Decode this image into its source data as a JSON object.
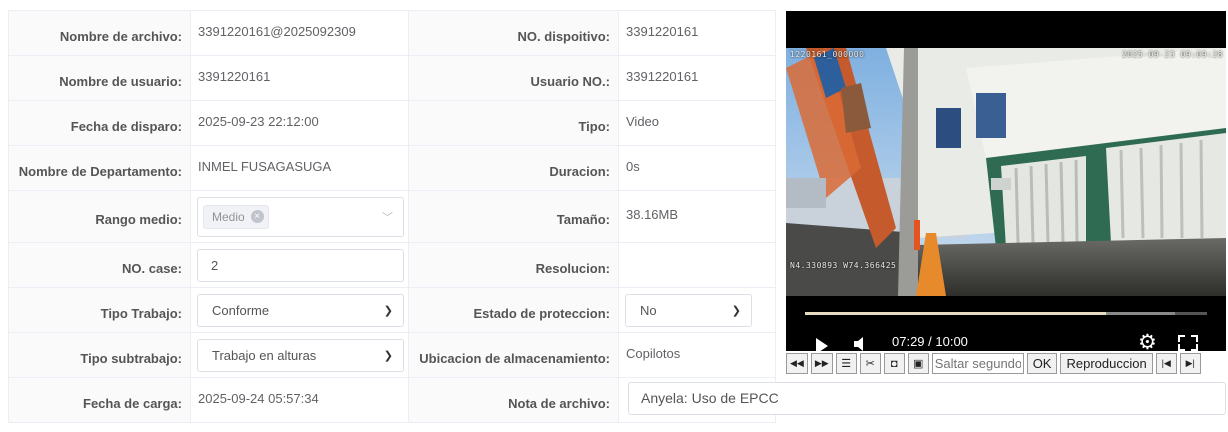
{
  "form": {
    "rows": [
      {
        "l1": "Nombre de archivo:",
        "v1": "3391220161@2025092309",
        "l2": "NO. dispoitivo:",
        "v2": "3391220161"
      },
      {
        "l1": "Nombre de usuario:",
        "v1": "3391220161",
        "l2": "Usuario NO.:",
        "v2": "3391220161"
      },
      {
        "l1": "Fecha de disparo:",
        "v1": "2025-09-23 22:12:00",
        "l2": "Tipo:",
        "v2": "Video"
      },
      {
        "l1": "Nombre de Departamento:",
        "v1": "INMEL FUSAGASUGA",
        "l2": "Duracion:",
        "v2": "0s"
      },
      {
        "l1": "Rango medio:",
        "v1_tag": "Medio",
        "l2": "Tamaño:",
        "v2": "38.16MB"
      },
      {
        "l1": "NO. case:",
        "v1_input": "2",
        "l2": "Resolucion:",
        "v2": ""
      },
      {
        "l1": "Tipo Trabajo:",
        "v1_select": "Conforme",
        "l2": "Estado de proteccion:",
        "v2_select": "No"
      },
      {
        "l1": "Tipo subtrabajo:",
        "v1_select": "Trabajo en alturas",
        "l2": "Ubicacion de almacenamiento:",
        "v2": "Copilotos"
      },
      {
        "l1": "Fecha de carga:",
        "v1": "2025-09-24 05:57:34",
        "l2": "Nota de archivo:",
        "v2_input": "Anyela: Uso de EPCC"
      }
    ]
  },
  "player": {
    "osd_id": "1220161_000000",
    "osd_datetime": "2025-09-23 09:09:28",
    "osd_gps": "N4.330893 W74.366425",
    "time_display": "07:29 / 10:00",
    "progress_fraction": 0.749,
    "buffered_fraction": 0.92
  },
  "toolbar": {
    "buttons": [
      {
        "name": "rewind-icon",
        "glyph": "◀◀"
      },
      {
        "name": "fast-forward-icon",
        "glyph": "▶▶"
      },
      {
        "name": "list-icon",
        "glyph": "☰"
      },
      {
        "name": "scissors-icon",
        "glyph": "✂"
      },
      {
        "name": "frame-back-icon",
        "glyph": "◘"
      },
      {
        "name": "frame-forward-icon",
        "glyph": "▣"
      }
    ],
    "seek_placeholder": "Saltar segundo",
    "ok_label": "OK",
    "playback_label": "Reproduccion",
    "skip_start_glyph": "|◀",
    "skip_end_glyph": "▶|"
  },
  "colors": {
    "label_bg": "#fafafa",
    "border": "#ebeef5",
    "progress": "#e6dcc4"
  }
}
